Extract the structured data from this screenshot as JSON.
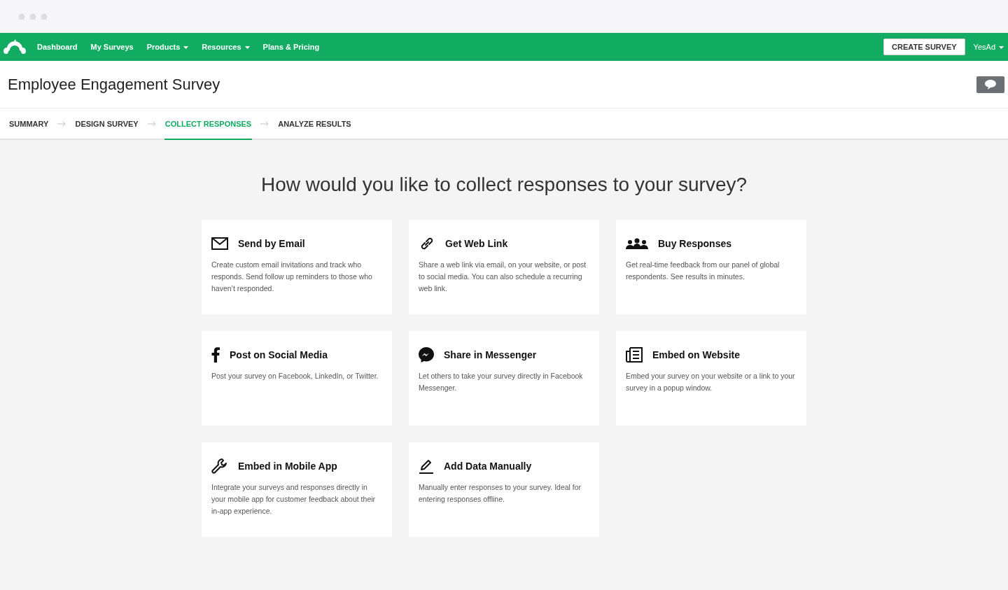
{
  "nav": {
    "items": [
      {
        "label": "Dashboard",
        "dropdown": false
      },
      {
        "label": "My Surveys",
        "dropdown": false
      },
      {
        "label": "Products",
        "dropdown": true
      },
      {
        "label": "Resources",
        "dropdown": true
      },
      {
        "label": "Plans & Pricing",
        "dropdown": false
      }
    ],
    "create_button": "CREATE SURVEY",
    "user": {
      "label": "YesAd",
      "dropdown": true
    }
  },
  "page_title": "Employee Engagement Survey",
  "steps": [
    {
      "label": "SUMMARY",
      "selected": false
    },
    {
      "label": "DESIGN SURVEY",
      "selected": false
    },
    {
      "label": "COLLECT RESPONSES",
      "selected": true
    },
    {
      "label": "ANALYZE RESULTS",
      "selected": false
    }
  ],
  "heading": "How would you like to collect responses to your survey?",
  "options": [
    {
      "kind": "email",
      "title": "Send by Email",
      "text": "Create custom email invitations and track who responds. Send follow up reminders to those who haven’t responded."
    },
    {
      "kind": "link",
      "title": "Get Web Link",
      "text": "Share a web link via email, on your website, or post to social media. You can also schedule a recurring web link."
    },
    {
      "kind": "people",
      "title": "Buy Responses",
      "text": "Get real-time feedback from our panel of global respondents. See results in minutes."
    },
    {
      "kind": "social",
      "title": "Post on Social Media",
      "text": "Post your survey on Facebook, LinkedIn, or Twitter."
    },
    {
      "kind": "messenger",
      "title": "Share in Messenger",
      "text": "Let others to take your survey directly in Facebook Messenger."
    },
    {
      "kind": "embed",
      "title": "Embed on Website",
      "text": "Embed your survey on your website or a link to your survey in a popup window."
    },
    {
      "kind": "wrench",
      "title": "Embed in Mobile App",
      "text": "Integrate your surveys and responses directly in your mobile app for customer feedback about their in-app experience."
    },
    {
      "kind": "pencil",
      "title": "Add Data Manually",
      "text": "Manually enter responses to your survey. Ideal for entering responses offline."
    }
  ]
}
